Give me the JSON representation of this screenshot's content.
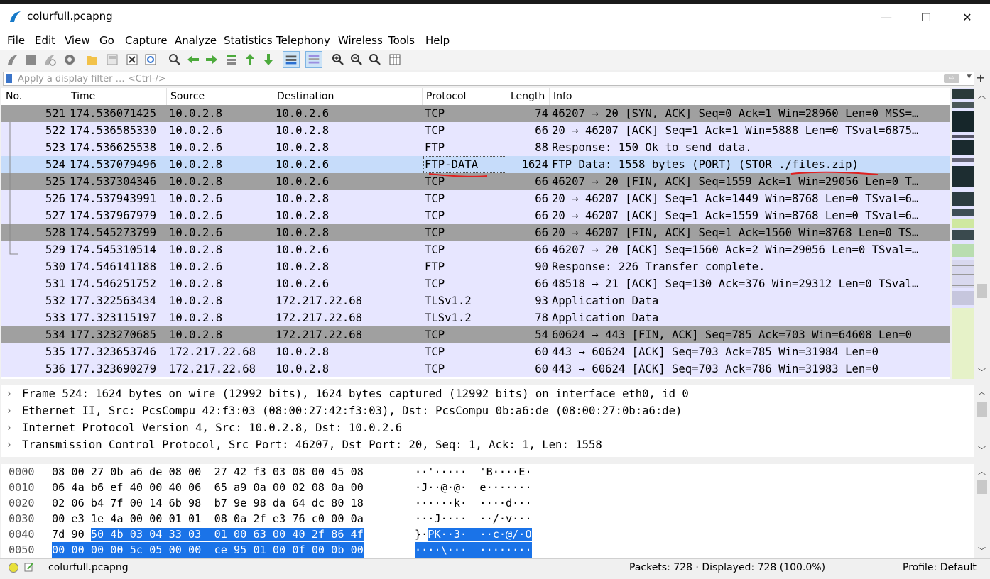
{
  "window": {
    "title": "colurfull.pcapng",
    "minimize": "—",
    "maximize": "☐",
    "close": "✕"
  },
  "menu": [
    "File",
    "Edit",
    "View",
    "Go",
    "Capture",
    "Analyze",
    "Statistics",
    "Telephony",
    "Wireless",
    "Tools",
    "Help"
  ],
  "toolbar_icons": [
    "start-capture-icon",
    "stop-capture-icon",
    "restart-capture-icon",
    "capture-options-icon",
    "open-file-icon",
    "save-file-icon",
    "close-file-icon",
    "reload-file-icon",
    "find-packet-icon",
    "go-back-icon",
    "go-forward-icon",
    "go-to-packet-icon",
    "go-first-icon",
    "go-last-icon",
    "autoscroll-icon",
    "colorize-icon",
    "zoom-in-icon",
    "zoom-out-icon",
    "normal-size-icon",
    "resize-columns-icon"
  ],
  "filter": {
    "placeholder": "Apply a display filter … <Ctrl-/>",
    "value": "",
    "add_label": "+"
  },
  "columns": [
    "No.",
    "Time",
    "Source",
    "Destination",
    "Protocol",
    "Length",
    "Info"
  ],
  "packets": [
    {
      "no": "521",
      "time": "174.536071425",
      "src": "10.0.2.8",
      "dst": "10.0.2.6",
      "proto": "TCP",
      "len": "74",
      "info": "46207 → 20 [SYN, ACK] Seq=0 Ack=1 Win=28960 Len=0 MSS=…",
      "style": "gray"
    },
    {
      "no": "522",
      "time": "174.536585330",
      "src": "10.0.2.6",
      "dst": "10.0.2.8",
      "proto": "TCP",
      "len": "66",
      "info": "20 → 46207 [ACK] Seq=1 Ack=1 Win=5888 Len=0 TSval=6875…",
      "style": "lav"
    },
    {
      "no": "523",
      "time": "174.536625538",
      "src": "10.0.2.6",
      "dst": "10.0.2.8",
      "proto": "FTP",
      "len": "88",
      "info": "Response: 150 Ok to send data.",
      "style": "lav"
    },
    {
      "no": "524",
      "time": "174.537079496",
      "src": "10.0.2.8",
      "dst": "10.0.2.6",
      "proto": "FTP-DATA",
      "len": "1624",
      "info": "FTP Data: 1558 bytes (PORT) (STOR ./files.zip)",
      "style": "sel"
    },
    {
      "no": "525",
      "time": "174.537304346",
      "src": "10.0.2.8",
      "dst": "10.0.2.6",
      "proto": "TCP",
      "len": "66",
      "info": "46207 → 20 [FIN, ACK] Seq=1559 Ack=1 Win=29056 Len=0 T…",
      "style": "gray"
    },
    {
      "no": "526",
      "time": "174.537943991",
      "src": "10.0.2.6",
      "dst": "10.0.2.8",
      "proto": "TCP",
      "len": "66",
      "info": "20 → 46207 [ACK] Seq=1 Ack=1449 Win=8768 Len=0 TSval=6…",
      "style": "lav"
    },
    {
      "no": "527",
      "time": "174.537967979",
      "src": "10.0.2.6",
      "dst": "10.0.2.8",
      "proto": "TCP",
      "len": "66",
      "info": "20 → 46207 [ACK] Seq=1 Ack=1559 Win=8768 Len=0 TSval=6…",
      "style": "lav"
    },
    {
      "no": "528",
      "time": "174.545273799",
      "src": "10.0.2.6",
      "dst": "10.0.2.8",
      "proto": "TCP",
      "len": "66",
      "info": "20 → 46207 [FIN, ACK] Seq=1 Ack=1560 Win=8768 Len=0 TS…",
      "style": "gray"
    },
    {
      "no": "529",
      "time": "174.545310514",
      "src": "10.0.2.8",
      "dst": "10.0.2.6",
      "proto": "TCP",
      "len": "66",
      "info": "46207 → 20 [ACK] Seq=1560 Ack=2 Win=29056 Len=0 TSval=…",
      "style": "lav"
    },
    {
      "no": "530",
      "time": "174.546141188",
      "src": "10.0.2.6",
      "dst": "10.0.2.8",
      "proto": "FTP",
      "len": "90",
      "info": "Response: 226 Transfer complete.",
      "style": "lav"
    },
    {
      "no": "531",
      "time": "174.546251752",
      "src": "10.0.2.8",
      "dst": "10.0.2.6",
      "proto": "TCP",
      "len": "66",
      "info": "48518 → 21 [ACK] Seq=130 Ack=376 Win=29312 Len=0 TSval…",
      "style": "lav"
    },
    {
      "no": "532",
      "time": "177.322563434",
      "src": "10.0.2.8",
      "dst": "172.217.22.68",
      "proto": "TLSv1.2",
      "len": "93",
      "info": "Application Data",
      "style": "lav"
    },
    {
      "no": "533",
      "time": "177.323115197",
      "src": "10.0.2.8",
      "dst": "172.217.22.68",
      "proto": "TLSv1.2",
      "len": "78",
      "info": "Application Data",
      "style": "lav"
    },
    {
      "no": "534",
      "time": "177.323270685",
      "src": "10.0.2.8",
      "dst": "172.217.22.68",
      "proto": "TCP",
      "len": "54",
      "info": "60624 → 443 [FIN, ACK] Seq=785 Ack=703 Win=64608 Len=0",
      "style": "gray"
    },
    {
      "no": "535",
      "time": "177.323653746",
      "src": "172.217.22.68",
      "dst": "10.0.2.8",
      "proto": "TCP",
      "len": "60",
      "info": "443 → 60624 [ACK] Seq=703 Ack=785 Win=31984 Len=0",
      "style": "lav"
    },
    {
      "no": "536",
      "time": "177.323690279",
      "src": "172.217.22.68",
      "dst": "10.0.2.8",
      "proto": "TCP",
      "len": "60",
      "info": "443 → 60624 [ACK] Seq=703 Ack=786 Win=31983 Len=0",
      "style": "lav"
    }
  ],
  "details": [
    "Frame 524: 1624 bytes on wire (12992 bits), 1624 bytes captured (12992 bits) on interface eth0, id 0",
    "Ethernet II, Src: PcsCompu_42:f3:03 (08:00:27:42:f3:03), Dst: PcsCompu_0b:a6:de (08:00:27:0b:a6:de)",
    "Internet Protocol Version 4, Src: 10.0.2.8, Dst: 10.0.2.6",
    "Transmission Control Protocol, Src Port: 46207, Dst Port: 20, Seq: 1, Ack: 1, Len: 1558"
  ],
  "bytes": [
    {
      "offset": "0000",
      "hex": "08 00 27 0b a6 de 08 00  27 42 f3 03 08 00 45 08",
      "ascii": "··'·····  'B····E·"
    },
    {
      "offset": "0010",
      "hex": "06 4a b6 ef 40 00 40 06  65 a9 0a 00 02 08 0a 00",
      "ascii": "·J··@·@·  e·······"
    },
    {
      "offset": "0020",
      "hex": "02 06 b4 7f 00 14 6b 98  b7 9e 98 da 64 dc 80 18",
      "ascii": "······k·  ····d···"
    },
    {
      "offset": "0030",
      "hex": "00 e3 1e 4a 00 00 01 01  08 0a 2f e3 76 c0 00 0a",
      "ascii": "···J····  ··/·v···"
    },
    {
      "offset": "0040",
      "hex_plain": "7d 90 ",
      "hex_hl": "50 4b 03 04 33 03  01 00 63 00 40 2f 86 4f",
      "ascii_plain": "}·",
      "ascii_hl": "PK··3·  ··c·@/·O"
    },
    {
      "offset": "0050",
      "hex_hl": "00 00 00 00 5c 05 00 00  ce 95 01 00 0f 00 0b 00",
      "ascii_hl": "····\\···  ········"
    }
  ],
  "status": {
    "file": "colurfull.pcapng",
    "packets": "Packets: 728 · Displayed: 728 (100.0%)",
    "profile": "Profile: Default"
  },
  "colors": {
    "lavender_row": "#e7e6ff",
    "gray_row": "#a0a0a0",
    "selected_row": "#c6dcfa",
    "byte_highlight": "#1a73e8",
    "annotation_red": "#e02020"
  }
}
